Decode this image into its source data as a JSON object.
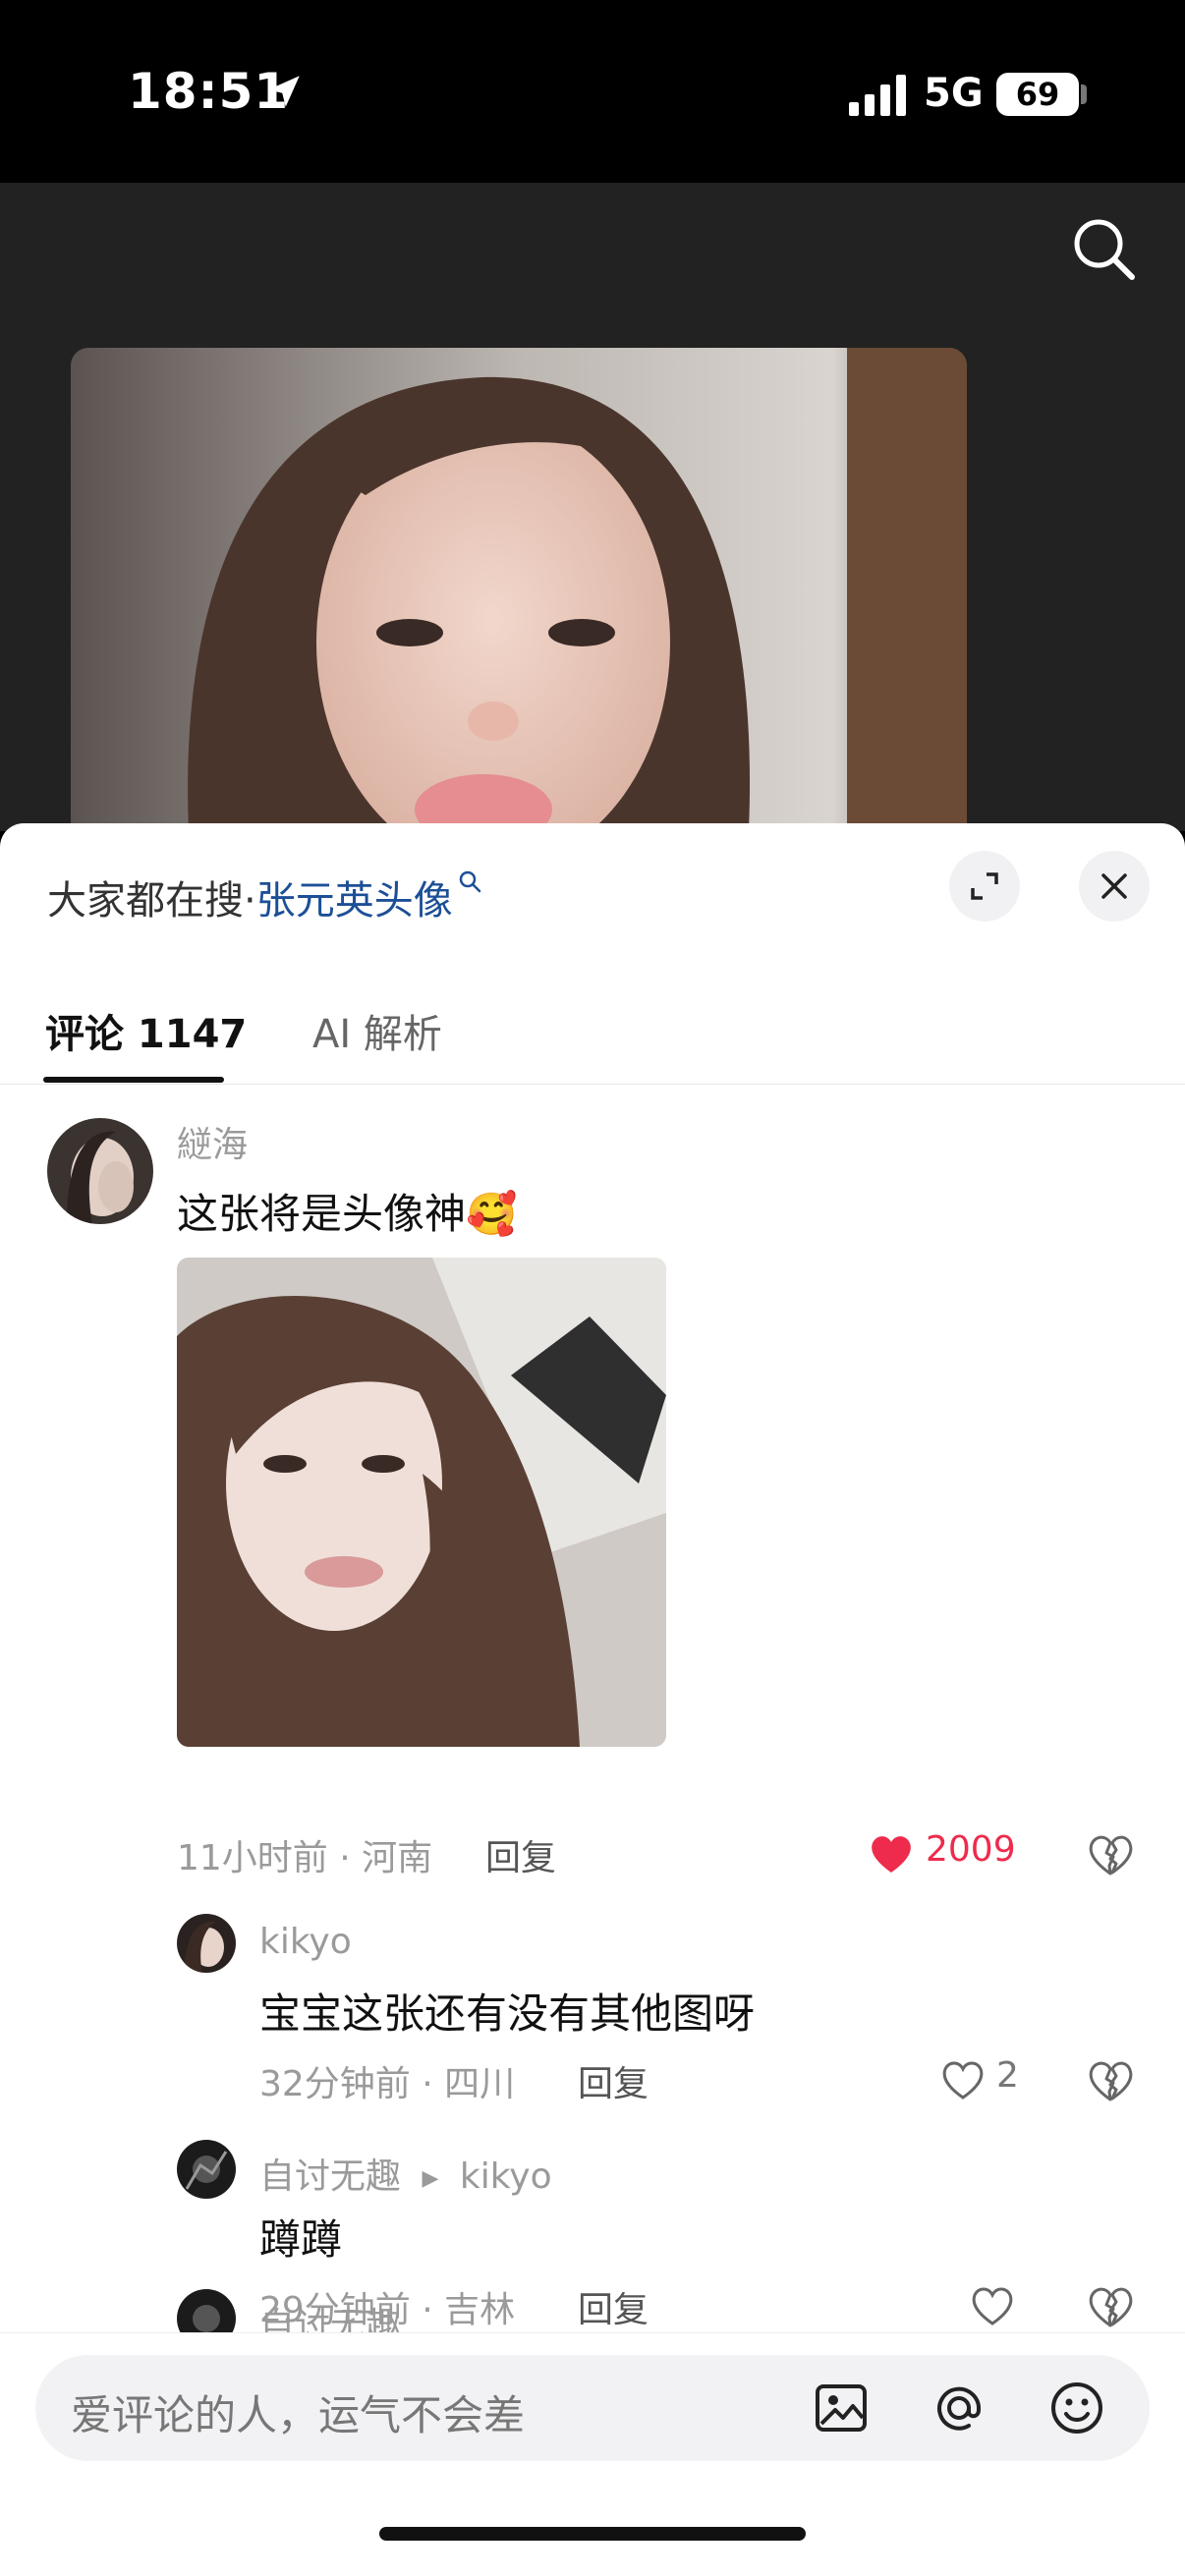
{
  "status_bar": {
    "time": "18:51",
    "network": "5G",
    "battery": "69"
  },
  "trending": {
    "prefix": "大家都在搜",
    "separator": "·",
    "term": "张元英头像"
  },
  "tabs": {
    "comments": "评论 1147",
    "ai": "AI 解析"
  },
  "comments": [
    {
      "user": "縌海",
      "text": "这张将是头像神🥰",
      "time": "11小时前",
      "location": "河南",
      "reply_label": "回复",
      "likes": "2009",
      "liked": true
    },
    {
      "user": "kikyo",
      "text": "宝宝这张还有没有其他图呀",
      "time": "32分钟前",
      "location": "四川",
      "reply_label": "回复",
      "likes": "2",
      "liked": false
    },
    {
      "user": "自讨无趣",
      "reply_to": "kikyo",
      "text": "蹲蹲",
      "time": "29分钟前",
      "location": "吉林",
      "reply_label": "回复",
      "likes": "",
      "liked": false
    },
    {
      "user": "自讨无趣"
    }
  ],
  "input": {
    "placeholder": "爱评论的人，运气不会差"
  },
  "icons": {
    "location": "location-arrow-icon",
    "signal": "cellular-signal-icon",
    "search": "search-icon",
    "expand": "expand-icon",
    "close": "close-icon",
    "heart": "heart-icon",
    "dislike": "broken-heart-icon",
    "image": "image-icon",
    "mention": "at-mention-icon",
    "emoji": "emoji-icon"
  },
  "colors": {
    "like": "#ee2b4c",
    "trend_link": "#1c4f96",
    "backdrop": "#222222"
  }
}
